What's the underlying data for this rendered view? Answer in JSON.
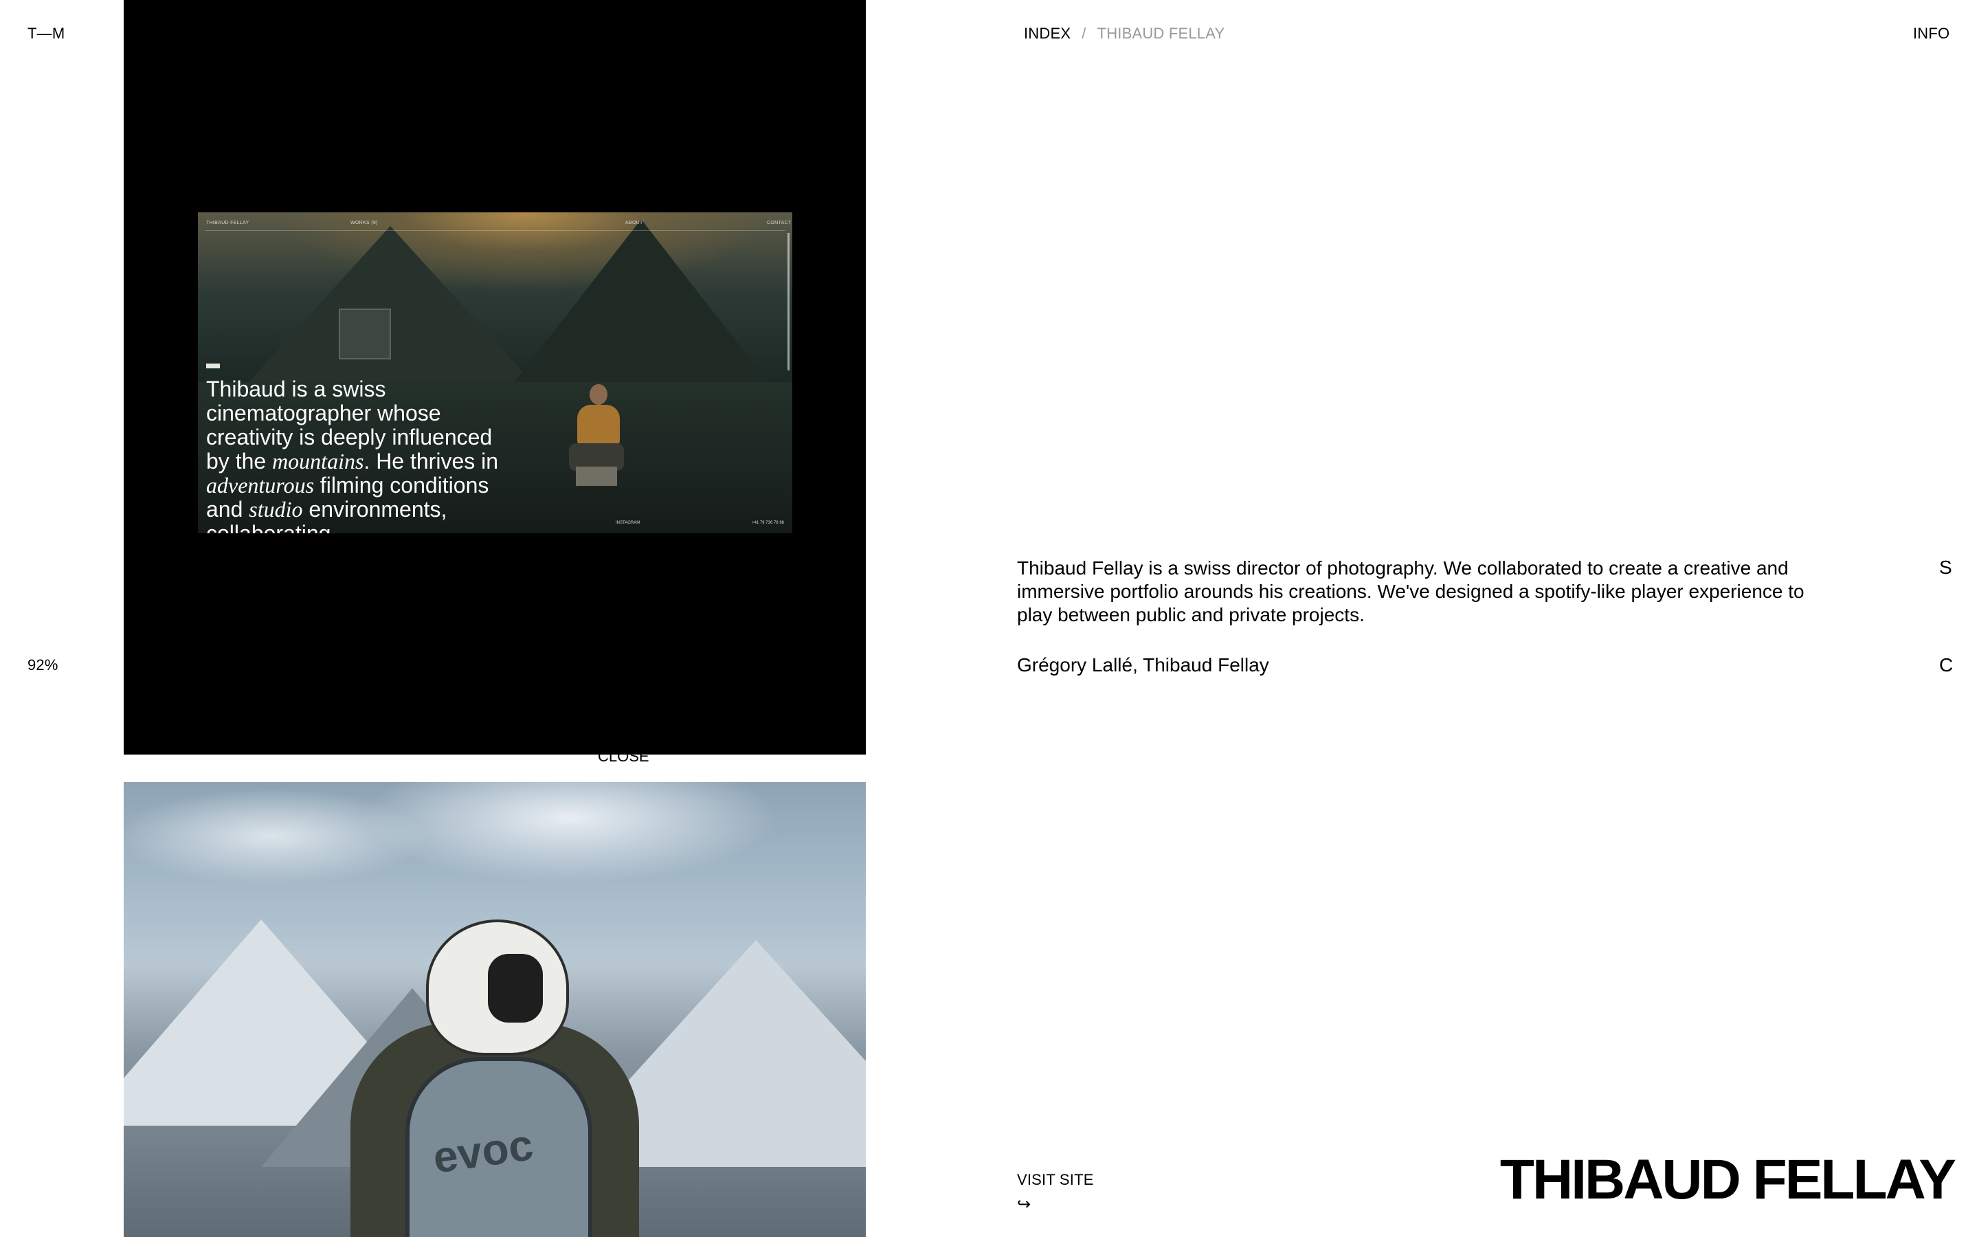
{
  "header": {
    "logo": "T—M",
    "breadcrumb": {
      "root": "INDEX",
      "separator": "/",
      "current": "THIBAUD FELLAY"
    },
    "info_label": "INFO"
  },
  "sidebar": {
    "progress": "92%"
  },
  "media": {
    "close_label": "CLOSE",
    "preview": {
      "nav": [
        "THIBAUD FELLAY",
        "WORKS (9)",
        "ABOUT",
        "CONTACT"
      ],
      "intro_parts": [
        "Thibaud is a swiss cinematographer whose creativity is deeply influenced by the ",
        "mountains",
        ". He thrives in ",
        "adventurous",
        " filming conditions and ",
        "studio",
        " environments, collaborating"
      ],
      "footer_left": "INSTAGRAM",
      "footer_right": "+41 79 736 78 96"
    },
    "second_image_logo": "evoc"
  },
  "project": {
    "description": "Thibaud Fellay is a swiss director of photography. We collaborated to create a creative and immersive portfolio arounds his creations. We've designed a spotify-like player experience to play between public and private projects.",
    "description_marker": "S",
    "credits": "Grégory Lallé, Thibaud Fellay",
    "credits_marker": "C",
    "visit_label": "VISIT SITE",
    "visit_arrow": "↪",
    "title": "THIBAUD FELLAY"
  }
}
